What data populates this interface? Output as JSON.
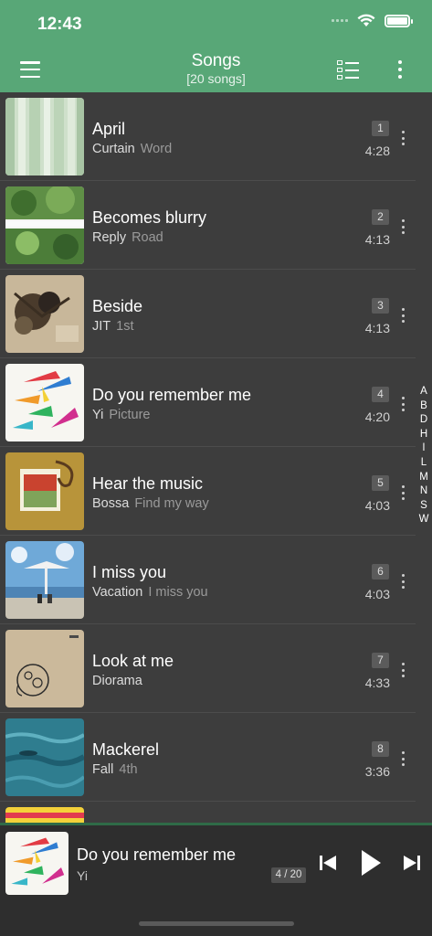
{
  "status_bar": {
    "time": "12:43"
  },
  "header": {
    "title": "Songs",
    "subtitle": "[20 songs]",
    "icons": [
      "menu-icon",
      "list-view-icon",
      "more-vertical-icon"
    ]
  },
  "colors": {
    "header_bg": "#58a777",
    "list_bg": "#3d3d3d",
    "player_bg": "#2e2e2e"
  },
  "songs": [
    {
      "title": "April",
      "artist": "Curtain",
      "album": "Word",
      "track": "1",
      "duration": "4:28"
    },
    {
      "title": "Becomes blurry",
      "artist": "Reply",
      "album": "Road",
      "track": "2",
      "duration": "4:13"
    },
    {
      "title": "Beside",
      "artist": "JIT",
      "album": "1st",
      "track": "3",
      "duration": "4:13"
    },
    {
      "title": "Do you remember me",
      "artist": "Yi",
      "album": "Picture",
      "track": "4",
      "duration": "4:20"
    },
    {
      "title": "Hear the music",
      "artist": "Bossa",
      "album": "Find my way",
      "track": "5",
      "duration": "4:03"
    },
    {
      "title": "I miss you",
      "artist": "Vacation",
      "album": "I miss you",
      "track": "6",
      "duration": "4:03"
    },
    {
      "title": "Look at me",
      "artist": "Diorama",
      "album": "",
      "track": "7",
      "duration": "4:33"
    },
    {
      "title": "Mackerel",
      "artist": "Fall",
      "album": "4th",
      "track": "8",
      "duration": "3:36"
    }
  ],
  "alpha_index": [
    "A",
    "B",
    "D",
    "H",
    "I",
    "L",
    "M",
    "N",
    "S",
    "W"
  ],
  "now_playing": {
    "title": "Do you remember me",
    "artist": "Yi",
    "position": "4 / 20",
    "controls": [
      "skip-previous-icon",
      "play-icon",
      "skip-next-icon"
    ]
  }
}
